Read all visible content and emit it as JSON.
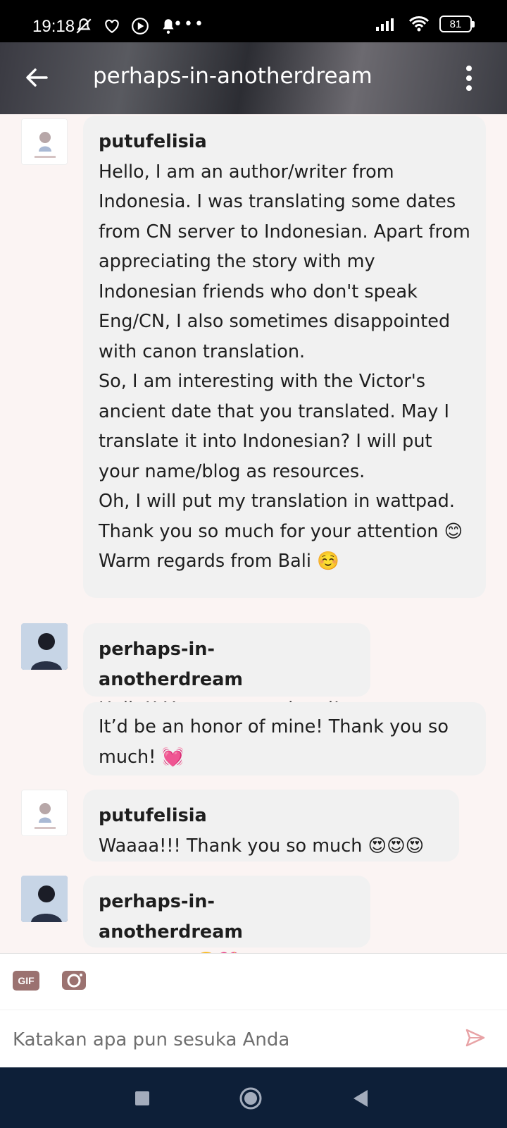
{
  "status_bar": {
    "time": "19:18",
    "battery": "81"
  },
  "header": {
    "title": "perhaps-in-anotherdream"
  },
  "messages": [
    {
      "sender": "putufelisia",
      "text": "Hello, I am an author/writer from Indonesia. I was translating some dates from CN server to Indonesian. Apart from appreciating the story with my Indonesian friends who don't speak Eng/CN, I also sometimes disappointed with canon translation.\nSo, I am interesting with the Victor's ancient date that you translated. May I translate it into Indonesian? I will put your name/blog as resources.\nOh, I will put my translation in wattpad.\nThank you so much for your attention 😊\nWarm regards from Bali ☺️"
    },
    {
      "sender": "perhaps-in-anotherdream",
      "text": "Hello!! Yes, sure go ahead!"
    },
    {
      "sender": "",
      "text": "It’d be an honor of mine! Thank you so much! 💓"
    },
    {
      "sender": "putufelisia",
      "text": "Waaaa!!! Thank you so much 😍😍😍"
    },
    {
      "sender": "perhaps-in-anotherdream",
      "text": "Pleasure!! 🥺💖"
    }
  ],
  "composer": {
    "gif_label": "GIF",
    "placeholder": "Katakan apa pun sesuka Anda"
  },
  "icons": {
    "back": "arrow-left-icon",
    "more": "vertical-dots-icon",
    "camera": "camera-icon",
    "send": "send-icon"
  },
  "colors": {
    "accent": "#9b7270",
    "navbar": "#0d1f38",
    "bubble": "#f1f1f1"
  }
}
